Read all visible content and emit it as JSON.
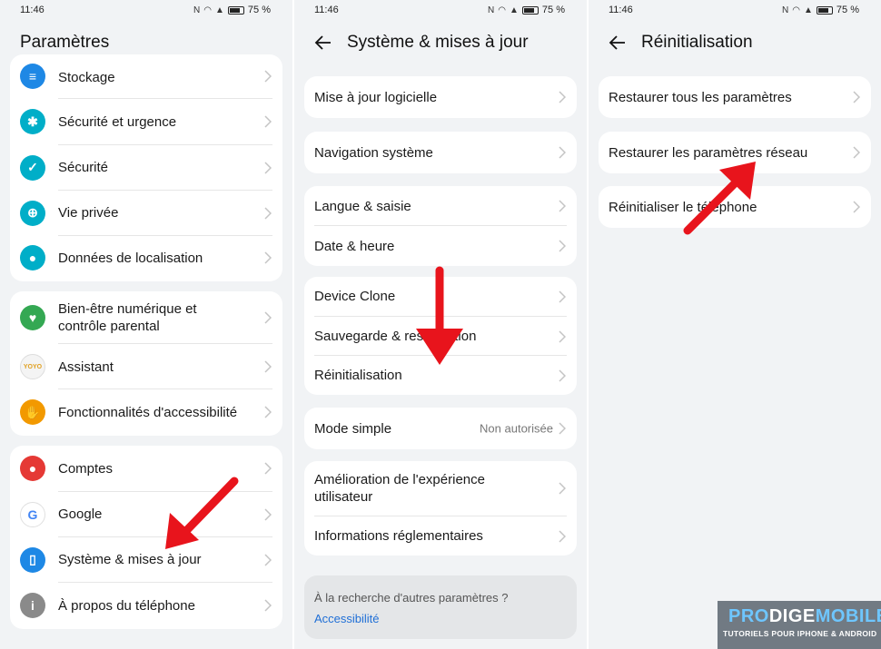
{
  "status": {
    "time": "11:46",
    "battery": "75 %"
  },
  "screen1": {
    "title": "Paramètres",
    "groups": [
      {
        "items": [
          {
            "label": "Stockage",
            "icon": "storage-icon",
            "color": "#1e88e5"
          },
          {
            "label": "Sécurité et urgence",
            "icon": "asterisk-icon",
            "color": "#00aec8"
          },
          {
            "label": "Sécurité",
            "icon": "shield-check-icon",
            "color": "#00aec8"
          },
          {
            "label": "Vie privée",
            "icon": "lock-icon",
            "color": "#00aec8"
          },
          {
            "label": "Données de localisation",
            "icon": "location-pin-icon",
            "color": "#00aec8"
          }
        ]
      },
      {
        "items": [
          {
            "label": "Bien-être numérique et contrôle parental",
            "icon": "heart-person-icon",
            "color": "#34a853"
          },
          {
            "label": "Assistant",
            "icon": "yoyo-icon",
            "color": "#f0f0f0"
          },
          {
            "label": "Fonctionnalités d'accessibilité",
            "icon": "hand-icon",
            "color": "#f29900"
          }
        ]
      },
      {
        "items": [
          {
            "label": "Comptes",
            "icon": "person-icon",
            "color": "#e53935"
          },
          {
            "label": "Google",
            "icon": "google-icon",
            "color": "#ffffff"
          },
          {
            "label": "Système & mises à jour",
            "icon": "phone-gear-icon",
            "color": "#1e88e5"
          },
          {
            "label": "À propos du téléphone",
            "icon": "info-icon",
            "color": "#8a8a8a"
          }
        ]
      }
    ]
  },
  "screen2": {
    "title": "Système & mises à jour",
    "groups": [
      {
        "items": [
          {
            "label": "Mise à jour logicielle"
          }
        ]
      },
      {
        "items": [
          {
            "label": "Navigation système"
          }
        ]
      },
      {
        "items": [
          {
            "label": "Langue & saisie"
          },
          {
            "label": "Date & heure"
          }
        ]
      },
      {
        "items": [
          {
            "label": "Device Clone"
          },
          {
            "label": "Sauvegarde & restauration"
          },
          {
            "label": "Réinitialisation"
          }
        ]
      },
      {
        "items": [
          {
            "label": "Mode simple",
            "value": "Non autorisée"
          }
        ]
      },
      {
        "items": [
          {
            "label": "Amélioration de l'expérience utilisateur"
          },
          {
            "label": "Informations réglementaires"
          }
        ]
      }
    ],
    "search": {
      "question": "À la recherche d'autres paramètres ?",
      "link": "Accessibilité"
    }
  },
  "screen3": {
    "title": "Réinitialisation",
    "groups": [
      {
        "items": [
          {
            "label": "Restaurer tous les paramètres"
          }
        ]
      },
      {
        "items": [
          {
            "label": "Restaurer les paramètres réseau"
          }
        ]
      },
      {
        "items": [
          {
            "label": "Réinitialiser le téléphone"
          }
        ]
      }
    ]
  },
  "brand": {
    "name_a": "PRO",
    "name_b": "DIGE",
    "name_c": "MOBILE",
    "tagline": "TUTORIELS POUR IPHONE & ANDROID"
  },
  "colors": {
    "arrow": "#e8141c",
    "accent": "#00aec8",
    "link": "#1f6fd6"
  }
}
